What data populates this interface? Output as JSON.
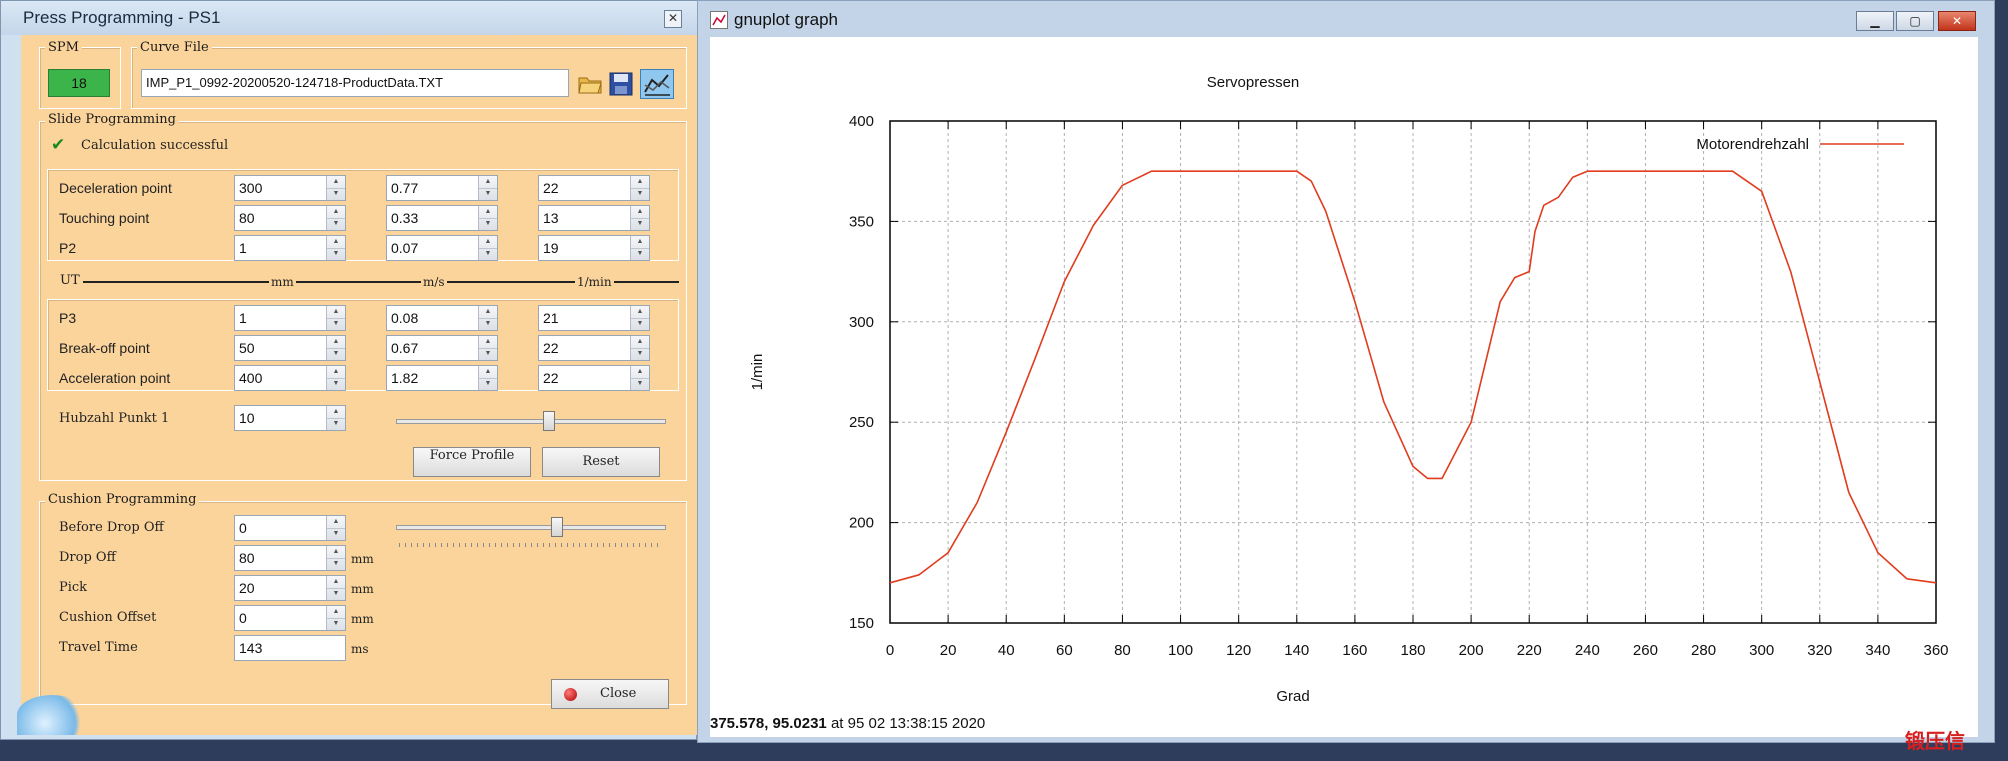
{
  "left_window": {
    "title": "Press Programming - PS1",
    "close_glyph": "✕",
    "spm": {
      "label": "SPM",
      "value": "18"
    },
    "curve_file": {
      "label": "Curve File",
      "value": "IMP_P1_0992-20200520-124718-ProductData.TXT"
    },
    "slide": {
      "label": "Slide Programming",
      "status": "Calculation successful",
      "rows_top": [
        {
          "label": "Deceleration point",
          "a": "300",
          "b": "0.77",
          "c": "22"
        },
        {
          "label": "Touching point",
          "a": "80",
          "b": "0.33",
          "c": "13"
        },
        {
          "label": "P2",
          "a": "1",
          "b": "0.07",
          "c": "19"
        }
      ],
      "ut_label": "UT",
      "unit_mm": "mm",
      "unit_ms": "m/s",
      "unit_min": "1/min",
      "rows_bottom": [
        {
          "label": "P3",
          "a": "1",
          "b": "0.08",
          "c": "21"
        },
        {
          "label": "Break-off point",
          "a": "50",
          "b": "0.67",
          "c": "22"
        },
        {
          "label": "Acceleration point",
          "a": "400",
          "b": "1.82",
          "c": "22"
        }
      ],
      "hubzahl": {
        "label": "Hubzahl Punkt 1",
        "value": "10",
        "slider_value": 0.57
      },
      "force_profile_label": "Force Profile",
      "reset_label": "Reset"
    },
    "cushion": {
      "label": "Cushion Programming",
      "rows": [
        {
          "label": "Before Drop Off",
          "value": "0",
          "unit": ""
        },
        {
          "label": "Drop Off",
          "value": "80",
          "unit": "mm"
        },
        {
          "label": "Pick",
          "value": "20",
          "unit": "mm"
        },
        {
          "label": "Cushion Offset",
          "value": "0",
          "unit": "mm"
        }
      ],
      "travel_time": {
        "label": "Travel Time",
        "value": "143",
        "unit": "ms"
      },
      "slider_value": 0.6
    },
    "close_label": "Close"
  },
  "right_window": {
    "title": "gnuplot graph",
    "status_value": "375.578, 95.0231",
    "status_time": "at 95 02 13:38:15 2020"
  },
  "chart_data": {
    "type": "line",
    "title": "Servopressen",
    "xlabel": "Grad",
    "ylabel": "1/min",
    "xlim": [
      0,
      360
    ],
    "ylim": [
      150,
      400
    ],
    "xticks": [
      0,
      20,
      40,
      60,
      80,
      100,
      120,
      140,
      160,
      180,
      200,
      220,
      240,
      260,
      280,
      300,
      320,
      340,
      360
    ],
    "yticks": [
      150,
      200,
      250,
      300,
      350,
      400
    ],
    "grid": true,
    "legend_position": "top-right",
    "series": [
      {
        "name": "Motorendrehzahl",
        "color": "#e03c1e",
        "x": [
          0,
          10,
          20,
          30,
          40,
          50,
          60,
          70,
          80,
          90,
          100,
          120,
          140,
          145,
          150,
          160,
          170,
          180,
          185,
          190,
          200,
          210,
          215,
          220,
          222,
          225,
          230,
          235,
          240,
          260,
          280,
          290,
          300,
          310,
          320,
          330,
          340,
          350,
          360
        ],
        "y": [
          170,
          174,
          185,
          210,
          245,
          282,
          320,
          348,
          368,
          375,
          375,
          375,
          375,
          370,
          355,
          310,
          260,
          228,
          222,
          222,
          250,
          310,
          322,
          325,
          345,
          358,
          362,
          372,
          375,
          375,
          375,
          375,
          365,
          325,
          270,
          215,
          185,
          172,
          170
        ]
      }
    ]
  },
  "watermark": "锻压信"
}
